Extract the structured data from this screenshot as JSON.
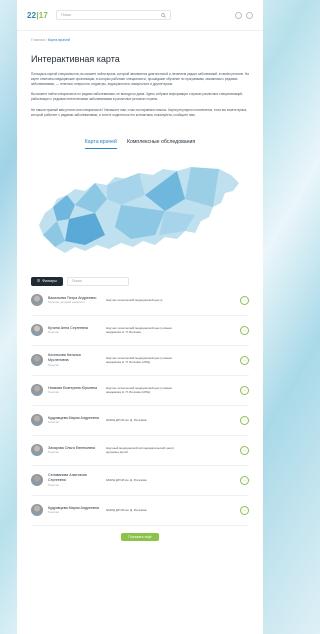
{
  "header": {
    "logo_main": "22",
    "logo_accent": "|17",
    "search_placeholder": "Поиск"
  },
  "breadcrumb": {
    "home": "Главная",
    "sep": "/",
    "current": "Карта врачей"
  },
  "page_title": "Интерактивная карта",
  "paragraphs": [
    "Пользуясь картой специалистов, вы можете найти врача, который занимается диагностикой и лечением редких заболеваний, в своём регионе. На карте отмечены медицинские организации, в которых работают специалисты, прошедшие обучение по программам, связанным с редкими заболеваниями, — генетики, неврологи, педиатры, эндокринологи, иммунологи и другие врачи.",
    "Вы можете найти специалиста по редким заболеваниям, не выходя из дома. Здесь собрана информация о врачах различных специализаций, работающих с редкими генетическими заболеваниями в различных регионах страны.",
    "Не нашли нужный вам регион или специалиста? Напишите нам, и мы постараемся помочь. Карта регулярно пополняется, если вы знаете врача, который работает с редкими заболеваниями, и хотите поделиться его контактами, пожалуйста, сообщите нам."
  ],
  "tabs": {
    "doctors": "Карта врачей",
    "exams": "Комплексные обследования"
  },
  "filters": {
    "button": "Фильтры",
    "search_placeholder": "Поиск"
  },
  "doctors": [
    {
      "name": "Васильева Петра Андреевич",
      "spec": "Генетик, детский невролог",
      "org": "Научно-технический медицинский центр",
      "avatar_color": "#c9b6a6"
    },
    {
      "name": "Кучина Анна Сергеевна",
      "spec": "Генетик",
      "org": "Научно-технический медицинский центр имени академика Н. П. Бочкова",
      "avatar_color": "#d6c3b2"
    },
    {
      "name": "Костюкова Наталья Мусленовна",
      "spec": "Генетик",
      "org": "Научно-технический медицинский центр имени академика Н. П. Бочкова (НПЦ)",
      "avatar_color": "#b8a698"
    },
    {
      "name": "Ниязова Екатерина Юрьевна",
      "spec": "Генетик",
      "org": "Научно-технический медицинский центр имени академика Н. П. Бочкова (НПЦ)",
      "avatar_color": "#c1aa9b"
    },
    {
      "name": "Кудрявцева Мария Андреевна",
      "spec": "Генетик",
      "org": "НМИЦ ДГОИ им. Д. Рогачёва",
      "avatar_color": "#bfb0a4"
    },
    {
      "name": "Захарова Ольга Евгеньевна",
      "spec": "Генетик",
      "org": "Научный медицинский исследовательский центр здоровья детей",
      "avatar_color": "#cab9ab"
    },
    {
      "name": "Селиванова Анастасия Сергеевна",
      "spec": "Генетик",
      "org": "НМИЦ ДГОИ им. Д. Рогачёва",
      "avatar_color": "#b3a294"
    },
    {
      "name": "Кудрявцева Мария Андреевна",
      "spec": "Генетик",
      "org": "НМИЦ ДГОИ им. Д. Рогачёва",
      "avatar_color": "#c4b3a5"
    }
  ],
  "more_button": "Показать ещё",
  "colors": {
    "accent": "#2a86c6",
    "green": "#8bc34a",
    "map_light": "#bfe0ef",
    "map_dark": "#6fb7dc"
  }
}
